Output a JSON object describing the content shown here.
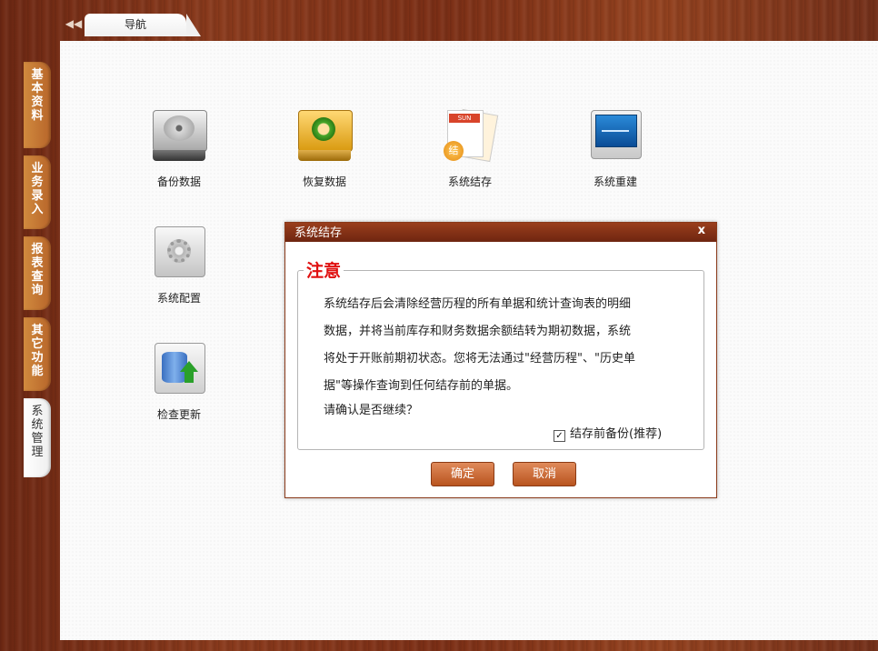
{
  "nav": {
    "collapse_icon": "double-left-arrow-icon",
    "tab_label": "导航"
  },
  "side_tabs": [
    {
      "label": "基本资料",
      "active": false
    },
    {
      "label": "业务录入",
      "active": false
    },
    {
      "label": "报表查询",
      "active": false
    },
    {
      "label": "其它功能",
      "active": false
    },
    {
      "label": "系统管理",
      "active": true
    }
  ],
  "tiles": [
    {
      "label": "备份数据",
      "icon": "hard-disk-icon"
    },
    {
      "label": "恢复数据",
      "icon": "restore-icon"
    },
    {
      "label": "系统结存",
      "icon": "settlement-document-icon"
    },
    {
      "label": "系统重建",
      "icon": "monitor-icon"
    },
    {
      "label": "系统配置",
      "icon": "gear-icon"
    },
    {
      "label": "检查更新",
      "icon": "database-update-icon"
    }
  ],
  "dialog": {
    "title": "系统结存",
    "close": "x",
    "section_title": "注意",
    "message_lines": [
      "系统结存后会清除经营历程的所有单据和统计查询表的明细",
      "数据，并将当前库存和财务数据余额结转为期初数据，系统",
      "将处于开账前期初状态。您将无法通过\"经营历程\"、\"历史单",
      "据\"等操作查询到任何结存前的单据。"
    ],
    "confirm_text": "请确认是否继续？",
    "checkbox_label": "结存前备份(推荐)",
    "checkbox_checked": true,
    "checkbox_mark": "✓",
    "ok_label": "确定",
    "cancel_label": "取消"
  },
  "colors": {
    "accent": "#8a3a1a",
    "legend_red": "#e01010",
    "button": "#c8622c"
  }
}
